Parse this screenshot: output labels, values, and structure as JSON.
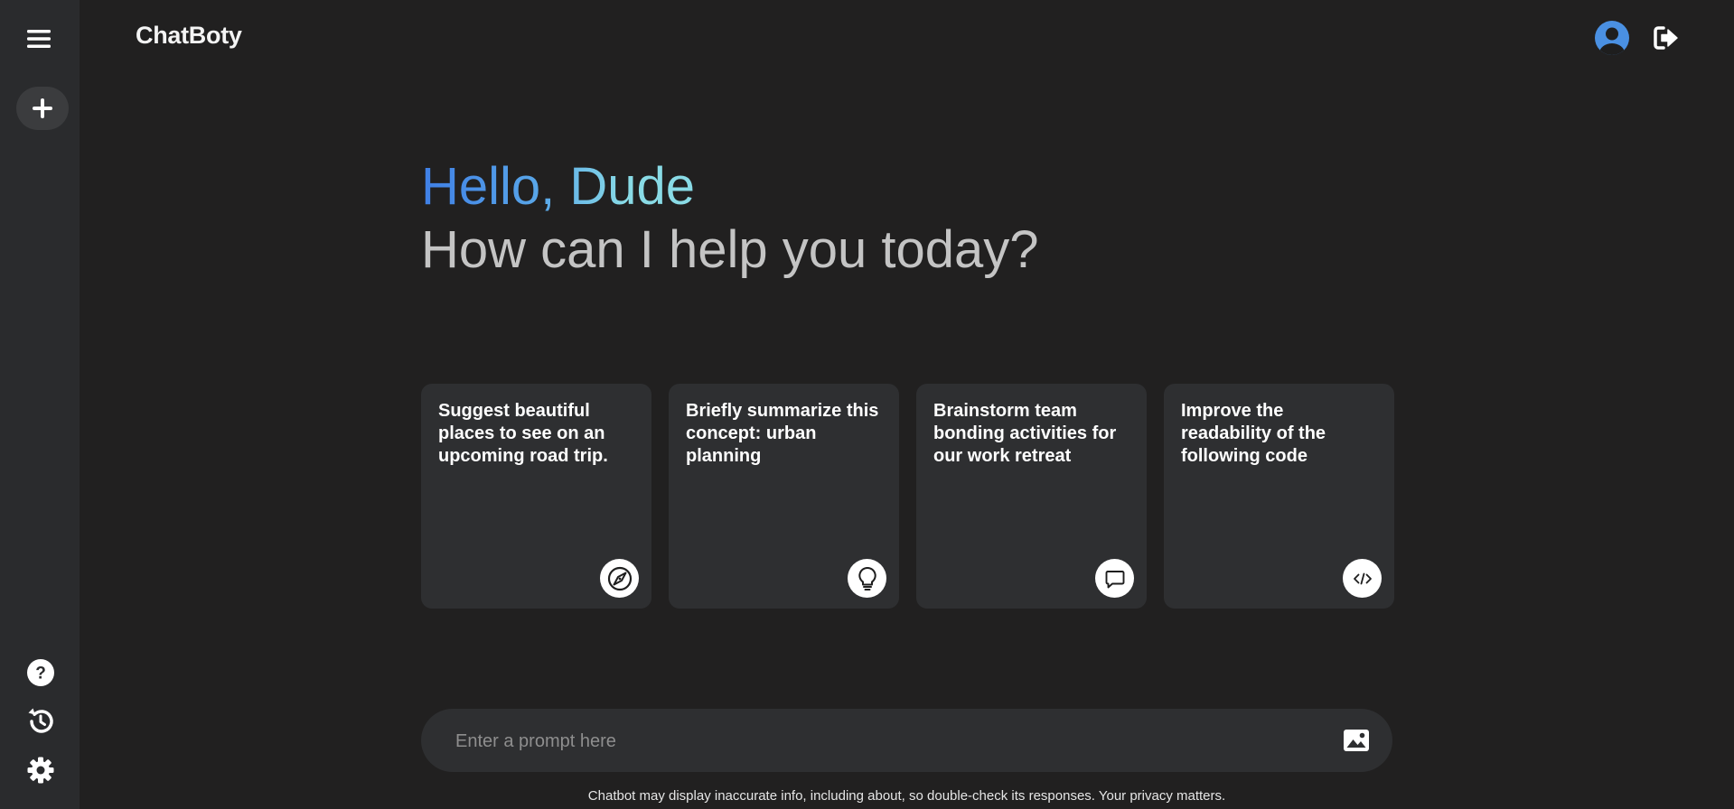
{
  "app": {
    "brand": "ChatBoty"
  },
  "greeting": {
    "hello": "Hello, Dude",
    "subtitle": "How can I help you today?"
  },
  "cards": [
    {
      "text": "Suggest beautiful places to see on an upcoming road trip.",
      "icon": "compass-icon"
    },
    {
      "text": "Briefly summarize this concept: urban planning",
      "icon": "lightbulb-icon"
    },
    {
      "text": "Brainstorm team bonding activities for our work retreat",
      "icon": "chat-bubble-icon"
    },
    {
      "text": "Improve the readability of the following code",
      "icon": "code-icon"
    }
  ],
  "prompt": {
    "placeholder": "Enter a prompt here",
    "value": ""
  },
  "footer": {
    "disclaimer": "Chatbot may display inaccurate info, including about, so double-check its responses. Your privacy matters."
  },
  "colors": {
    "background": "#212020",
    "sidebar": "#2a2b2d",
    "card": "#2e2f31",
    "gradient_start": "#3f7fe6",
    "gradient_end": "#89dbe6",
    "subtitle": "#c4c4c4",
    "avatar": "#4a90e2"
  }
}
